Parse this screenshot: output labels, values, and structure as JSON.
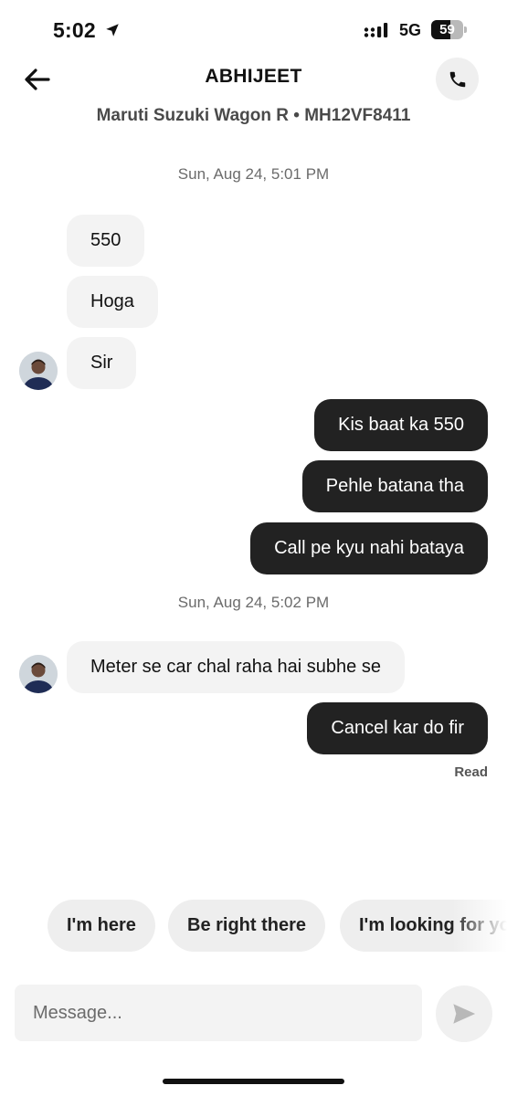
{
  "status_bar": {
    "time": "5:02",
    "network": "5G",
    "battery_level": "59",
    "battery_fraction": 0.59
  },
  "header": {
    "driver_name": "ABHIJEET",
    "vehicle": "Maruti Suzuki Wagon R • MH12VF8411",
    "back_icon": "arrow-left-icon",
    "call_icon": "phone-icon"
  },
  "conversation": {
    "timestamps": [
      "Sun, Aug 24, 5:01 PM",
      "Sun, Aug 24, 5:02 PM"
    ],
    "messages": [
      {
        "from": "driver",
        "text": "550"
      },
      {
        "from": "driver",
        "text": "Hoga"
      },
      {
        "from": "driver",
        "text": "Sir"
      },
      {
        "from": "me",
        "text": "Kis baat ka 550"
      },
      {
        "from": "me",
        "text": "Pehle batana tha"
      },
      {
        "from": "me",
        "text": "Call pe kyu nahi bataya"
      },
      {
        "from": "driver",
        "text": "Meter se car chal raha hai subhe se"
      },
      {
        "from": "me",
        "text": "Cancel kar do fir"
      }
    ],
    "read_receipt": "Read"
  },
  "quick_replies": [
    "I'm here",
    "Be right there",
    "I'm looking for you"
  ],
  "composer": {
    "placeholder": "Message...",
    "value": "",
    "send_icon": "send-icon"
  },
  "colors": {
    "incoming_bubble": "#f3f3f3",
    "outgoing_bubble": "#222222",
    "chip_background": "#eeeeee"
  }
}
